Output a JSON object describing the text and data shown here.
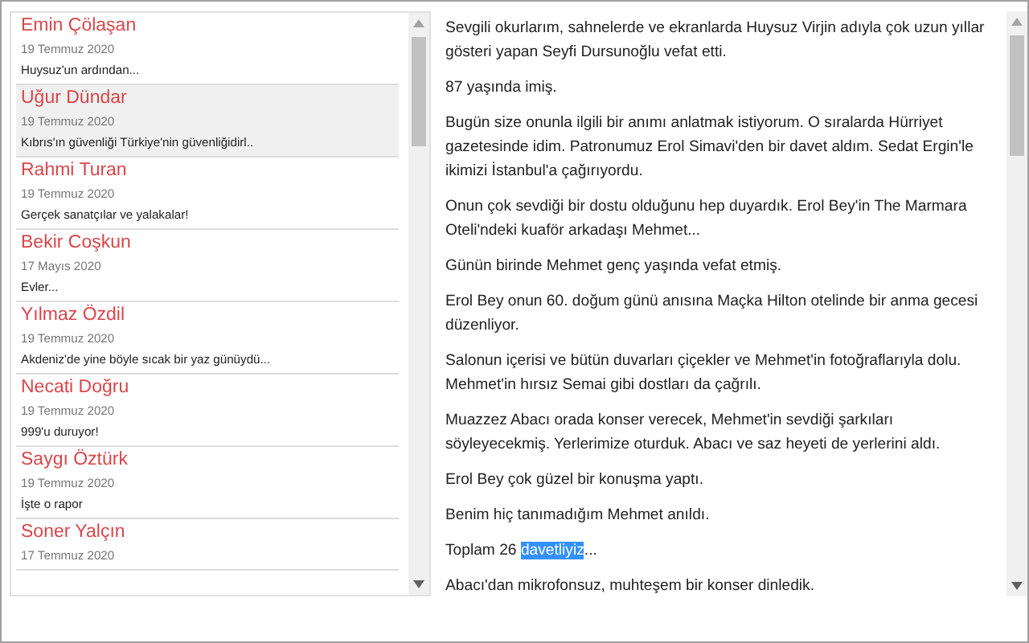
{
  "columns": [
    {
      "name": "Emin Çölaşan",
      "date": "19 Temmuz 2020",
      "summary": "Huysuz'un ardından...",
      "selected": false
    },
    {
      "name": "Uğur Dündar",
      "date": "19 Temmuz 2020",
      "summary": "Kıbrıs'ın güvenliği Türkiye'nin güvenliğidirl..",
      "selected": true
    },
    {
      "name": "Rahmi Turan",
      "date": "19 Temmuz 2020",
      "summary": "Gerçek sanatçılar ve yalakalar!",
      "selected": false
    },
    {
      "name": "Bekir Coşkun",
      "date": "17 Mayıs 2020",
      "summary": "Evler...",
      "selected": false
    },
    {
      "name": "Yılmaz Özdil",
      "date": "19 Temmuz 2020",
      "summary": "Akdeniz'de yine böyle sıcak bir yaz günüydü...",
      "selected": false
    },
    {
      "name": "Necati Doğru",
      "date": "19 Temmuz 2020",
      "summary": "999'u duruyor!",
      "selected": false
    },
    {
      "name": "Saygı Öztürk",
      "date": "19 Temmuz 2020",
      "summary": "İşte o rapor",
      "selected": false
    },
    {
      "name": "Soner Yalçın",
      "date": "17 Temmuz 2020",
      "selected": false
    }
  ],
  "article": [
    [
      {
        "text": "Sevgili okurlarım, sahnelerde ve ekranlarda Huysuz Virjin adıyla çok uzun yıllar gösteri yapan Seyfi Dursunoğlu vefat etti.",
        "selected": false
      }
    ],
    [
      {
        "text": "87 yaşında imiş.",
        "selected": false
      }
    ],
    [
      {
        "text": "Bugün size onunla ilgili bir anımı anlatmak istiyorum. O sıralarda Hürriyet gazetesinde idim. Patronumuz Erol Simavi'den bir davet aldım. Sedat Ergin'le ikimizi İstanbul'a çağırıyordu.",
        "selected": false
      }
    ],
    [
      {
        "text": "Onun çok sevdiği bir dostu olduğunu hep duyardık. Erol Bey'in The Marmara Oteli'ndeki kuaför arkadaşı Mehmet...",
        "selected": false
      }
    ],
    [
      {
        "text": "Günün birinde Mehmet genç yaşında vefat etmiş.",
        "selected": false
      }
    ],
    [
      {
        "text": "Erol Bey onun 60. doğum günü anısına Maçka Hilton otelinde bir anma gecesi düzenliyor.",
        "selected": false
      }
    ],
    [
      {
        "text": "Salonun içerisi ve bütün duvarları çiçekler ve Mehmet'in fotoğraflarıyla dolu. Mehmet'in hırsız Semai gibi dostları da çağrılı.",
        "selected": false
      }
    ],
    [
      {
        "text": "Muazzez Abacı orada konser verecek, Mehmet'in sevdiği şarkıları söyleyecekmiş. Yerlerimize oturduk. Abacı ve saz heyeti de yerlerini aldı.",
        "selected": false
      }
    ],
    [
      {
        "text": "Erol Bey çok güzel bir konuşma yaptı.",
        "selected": false
      }
    ],
    [
      {
        "text": "Benim hiç tanımadığım Mehmet anıldı.",
        "selected": false
      }
    ],
    [
      {
        "text": "Toplam 26 ",
        "selected": false
      },
      {
        "text": "davetliyiz",
        "selected": true
      },
      {
        "text": "...",
        "selected": false
      }
    ],
    [
      {
        "text": "Abacı'dan mikrofonsuz, muhteşem bir konser dinledik.",
        "selected": false
      }
    ]
  ]
}
